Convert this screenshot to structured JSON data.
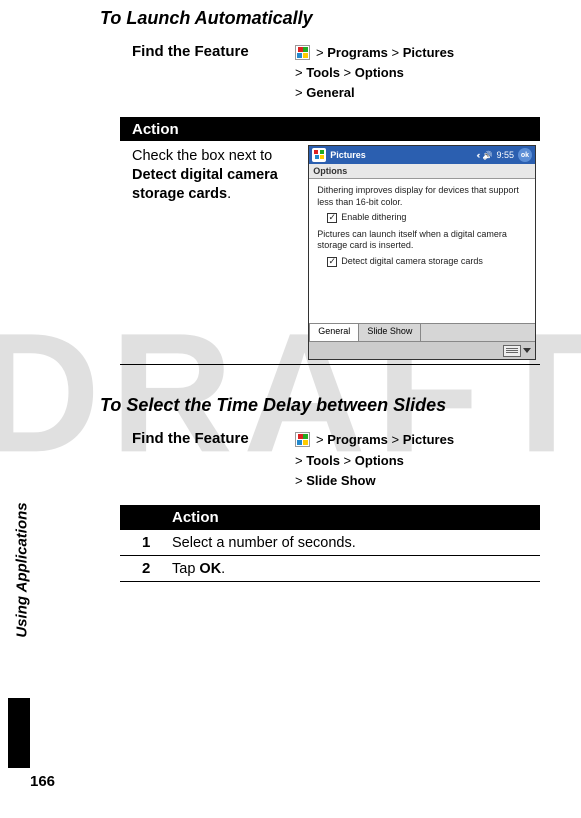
{
  "watermark": "DRAFT",
  "side_label": "Using Applications",
  "page_number": "166",
  "section1": {
    "heading": "To Launch Automatically",
    "find_label": "Find the Feature",
    "path_parts": {
      "p1": "Programs",
      "p2": "Pictures",
      "p3": "Tools",
      "p4": "Options",
      "p5": "General"
    },
    "action_head": "Action",
    "action_text_pre": "Check the box next to ",
    "action_text_bold": "Detect digital camera storage cards",
    "action_text_post": ".",
    "screenshot": {
      "title": "Pictures",
      "time": "9:55",
      "ok": "ok",
      "subtitle": "Options",
      "para1": "Dithering improves display for devices that support less than 16-bit color.",
      "cb1": "Enable dithering",
      "para2": "Pictures can launch itself when a digital camera storage card is inserted.",
      "cb2": "Detect digital camera storage cards",
      "tab1": "General",
      "tab2": "Slide Show"
    }
  },
  "section2": {
    "heading": "To Select the Time Delay between Slides",
    "find_label": "Find the Feature",
    "path_parts": {
      "p1": "Programs",
      "p2": "Pictures",
      "p3": "Tools",
      "p4": "Options",
      "p5": "Slide Show"
    },
    "action_head": "Action",
    "steps": [
      {
        "n": "1",
        "text_pre": "Select a number of seconds.",
        "text_bold": "",
        "text_post": ""
      },
      {
        "n": "2",
        "text_pre": "Tap ",
        "text_bold": "OK",
        "text_post": "."
      }
    ]
  }
}
